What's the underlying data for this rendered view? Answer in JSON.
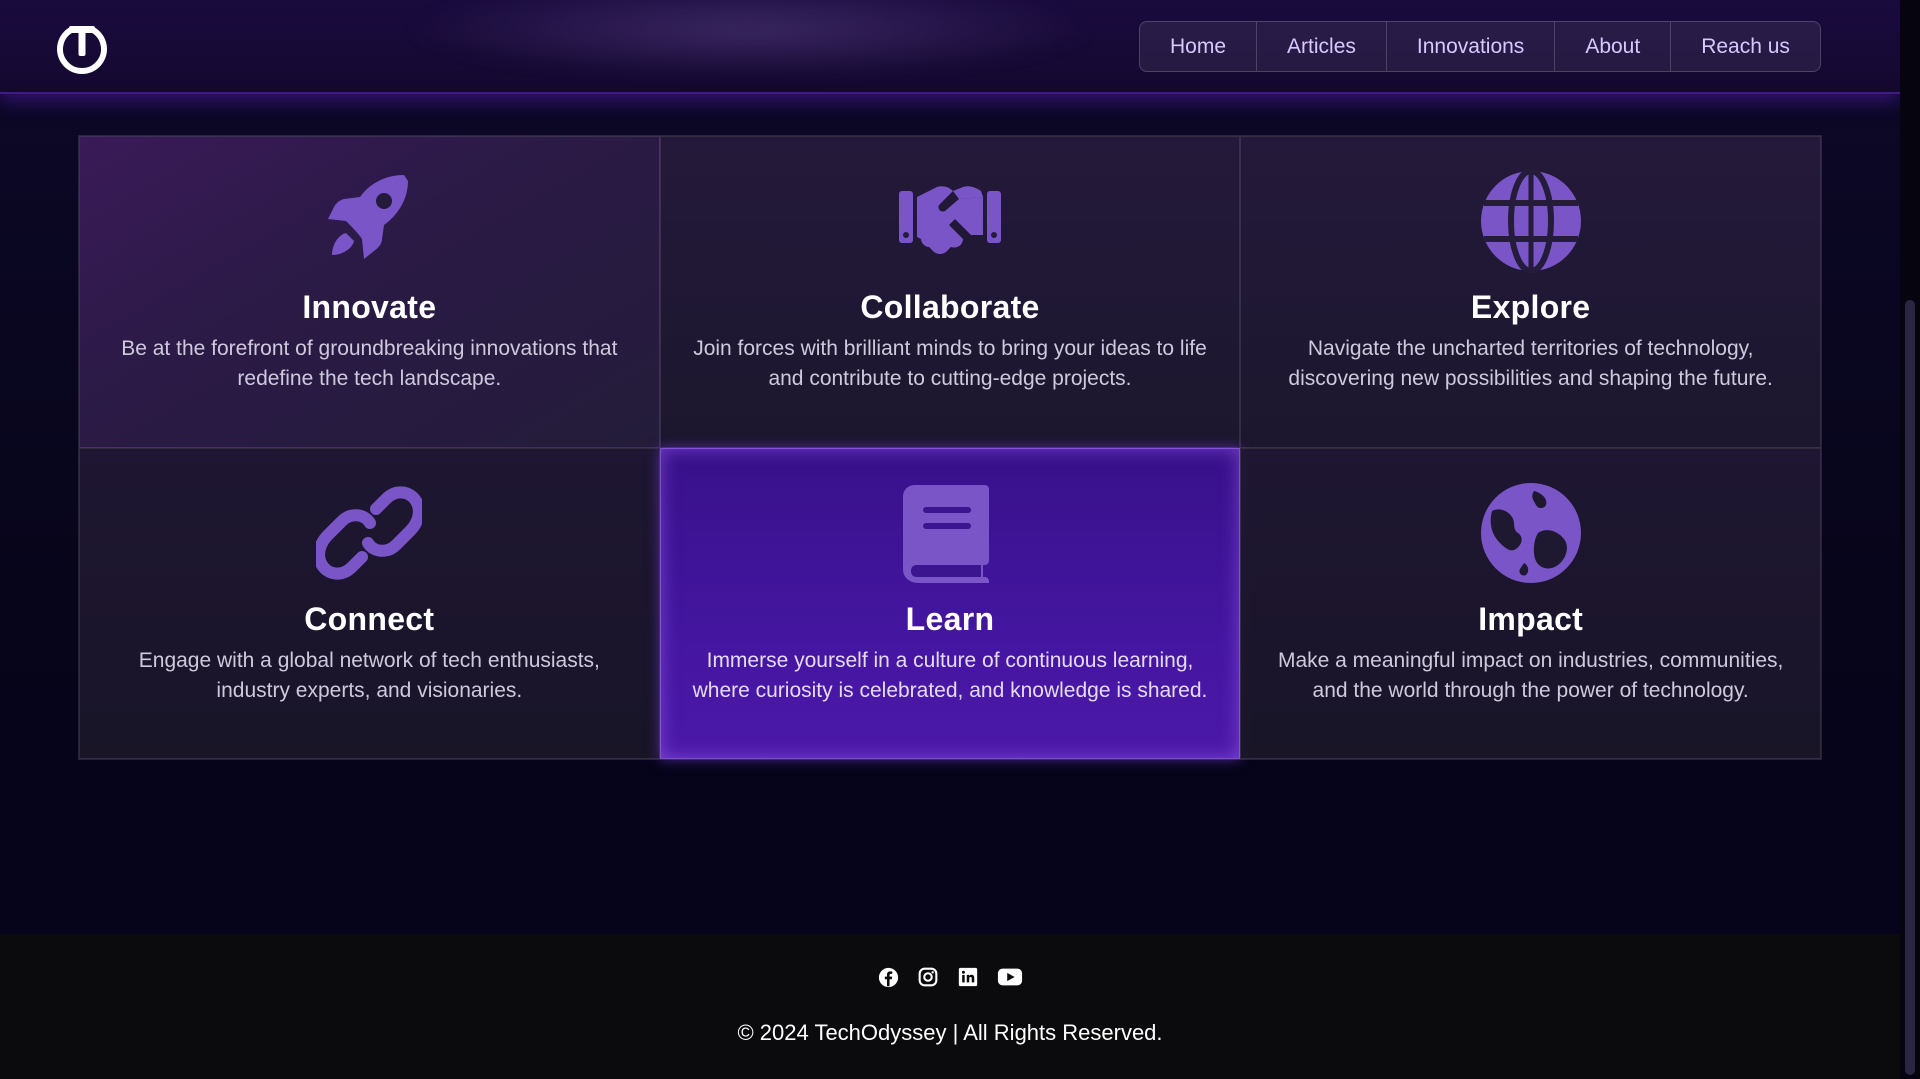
{
  "brand": {
    "logo_icon": "power-t-logo-icon",
    "accent": "#7a55c8"
  },
  "nav": {
    "items": [
      {
        "label": "Home"
      },
      {
        "label": "Articles"
      },
      {
        "label": "Innovations"
      },
      {
        "label": "About"
      },
      {
        "label": "Reach us"
      }
    ]
  },
  "features": [
    {
      "icon": "rocket-icon",
      "title": "Innovate",
      "text": "Be at the forefront of groundbreaking innovations that redefine the tech landscape."
    },
    {
      "icon": "handshake-icon",
      "title": "Collaborate",
      "text": "Join forces with brilliant minds to bring your ideas to life and contribute to cutting-edge projects."
    },
    {
      "icon": "globe-icon",
      "title": "Explore",
      "text": "Navigate the uncharted territories of technology, discovering new possibilities and shaping the future."
    },
    {
      "icon": "link-icon",
      "title": "Connect",
      "text": "Engage with a global network of tech enthusiasts, industry experts, and visionaries."
    },
    {
      "icon": "book-icon",
      "title": "Learn",
      "text": "Immerse yourself in a culture of continuous learning, where curiosity is celebrated, and knowledge is shared."
    },
    {
      "icon": "earth-icon",
      "title": "Impact",
      "text": "Make a meaningful impact on industries, communities, and the world through the power of technology."
    }
  ],
  "footer": {
    "social": [
      "facebook-icon",
      "instagram-icon",
      "linkedin-icon",
      "youtube-icon"
    ],
    "copyright": "© 2024 TechOdyssey | All Rights Reserved."
  }
}
